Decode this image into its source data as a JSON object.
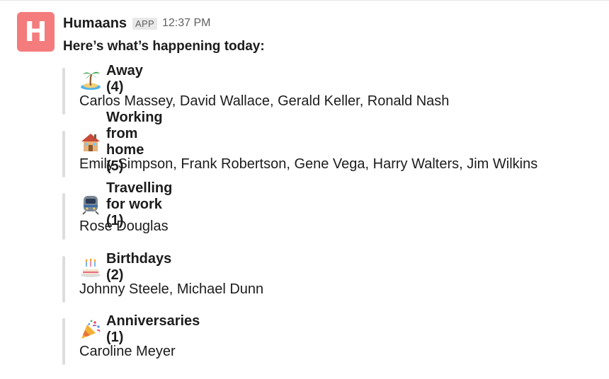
{
  "message": {
    "sender": "Humaans",
    "badge": "APP",
    "timestamp": "12:37 PM",
    "avatar_letter": "H",
    "intro": "Here’s what’s happening today:"
  },
  "sections": [
    {
      "icon": "island-icon",
      "title": "Away (4)",
      "people": "Carlos Massey, David Wallace, Gerald Keller, Ronald Nash"
    },
    {
      "icon": "house-icon",
      "title": "Working from home (5)",
      "people": "Emily Simpson, Frank Robertson, Gene Vega, Harry Walters, Jim Wilkins"
    },
    {
      "icon": "train-icon",
      "title": "Travelling for work (1)",
      "people": "Rose Douglas"
    },
    {
      "icon": "cake-icon",
      "title": "Birthdays (2)",
      "people": "Johnny Steele, Michael Dunn"
    },
    {
      "icon": "party-popper-icon",
      "title": "Anniversaries (1)",
      "people": "Caroline Meyer"
    }
  ],
  "colors": {
    "avatar": "#f47c7c",
    "quote_bar": "#dddddd",
    "text": "#1d1c1d",
    "muted": "#616061"
  }
}
